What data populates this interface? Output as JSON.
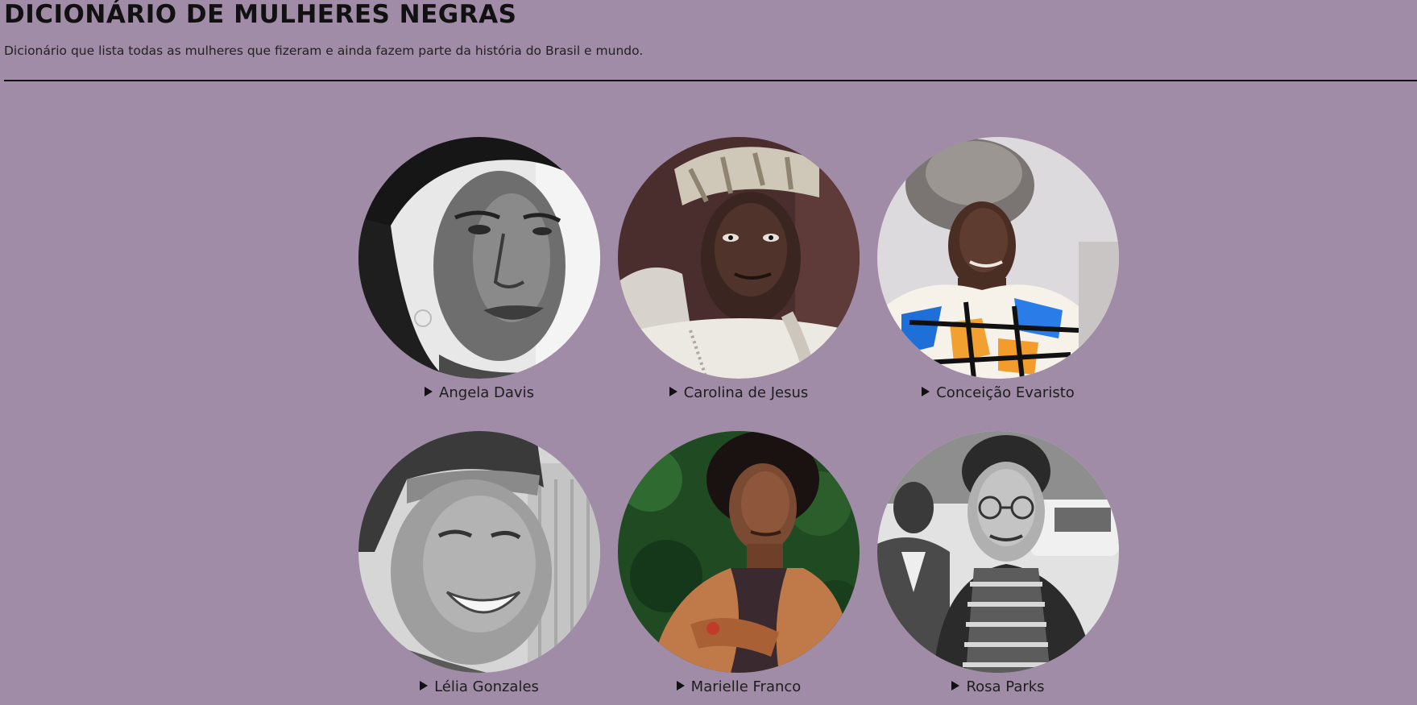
{
  "header": {
    "title": "DICIONÁRIO DE MULHERES NEGRAS",
    "subtitle": "Dicionário que lista todas as mulheres que fizeram e ainda fazem parte da história do Brasil e mundo."
  },
  "colors": {
    "background": "#a08ca6",
    "text": "#111111",
    "divider": "#111111"
  },
  "women": [
    {
      "name": "Angela Davis",
      "icon": "disclosure-triangle-right"
    },
    {
      "name": "Carolina de Jesus",
      "icon": "disclosure-triangle-right"
    },
    {
      "name": "Conceição Evaristo",
      "icon": "disclosure-triangle-right"
    },
    {
      "name": "Lélia Gonzales",
      "icon": "disclosure-triangle-right"
    },
    {
      "name": "Marielle Franco",
      "icon": "disclosure-triangle-right"
    },
    {
      "name": "Rosa Parks",
      "icon": "disclosure-triangle-right"
    }
  ]
}
